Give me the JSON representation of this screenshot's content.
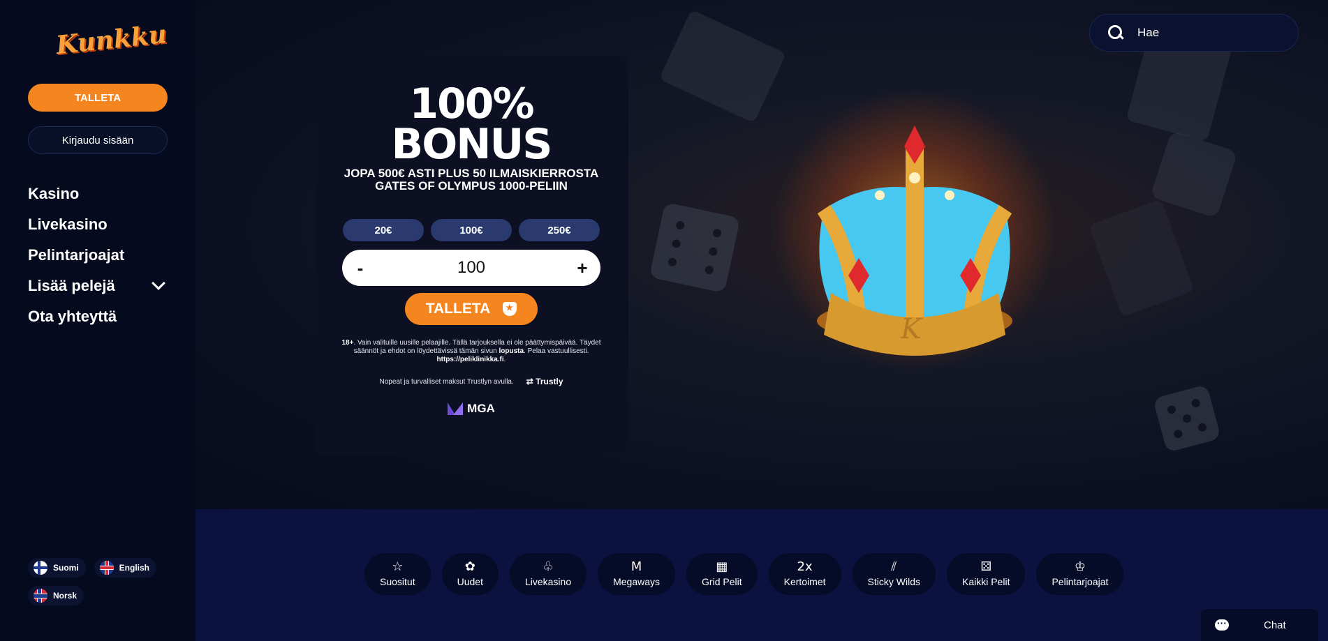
{
  "brand": {
    "logo_text": "Kunkku"
  },
  "sidebar": {
    "deposit_label": "TALLETA",
    "login_label": "Kirjaudu sisään",
    "nav": [
      {
        "label": "Kasino"
      },
      {
        "label": "Livekasino"
      },
      {
        "label": "Pelintarjoajat"
      },
      {
        "label": "Lisää pelejä"
      },
      {
        "label": "Ota yhteyttä"
      }
    ],
    "languages": [
      {
        "label": "Suomi"
      },
      {
        "label": "English"
      },
      {
        "label": "Norsk"
      }
    ]
  },
  "search": {
    "placeholder": "Hae"
  },
  "bonus": {
    "line1": "100%",
    "line2": "BONUS",
    "subtitle": "JOPA 500€ ASTI PLUS 50 ILMAISKIERROSTA GATES OF OLYMPUS 1000-PELIIN",
    "amounts": [
      "20€",
      "100€",
      "250€"
    ],
    "stepper_minus": "-",
    "stepper_value": "100",
    "stepper_plus": "+",
    "deposit_label": "TALLETA",
    "fine_age": "18+",
    "fine_text_1": ". Vain valituille uusille pelaajille. Tällä tarjouksella ei ole päättymispäivää. Täydet säännöt ja ehdot on löydettävissä tämän sivun ",
    "fine_link": "lopusta",
    "fine_text_2": ". Pelaa vastuullisesti.",
    "fine_url": "https://peliklinikka.fi",
    "trustly_text": "Nopeat ja turvalliset maksut Trustlyn avulla.",
    "trustly_logo": "Trustly",
    "mga_label": "MGA"
  },
  "categories": [
    {
      "label": "Suositut",
      "icon": "☆"
    },
    {
      "label": "Uudet",
      "icon": "✿"
    },
    {
      "label": "Livekasino",
      "icon": "♧"
    },
    {
      "label": "Megaways",
      "icon": "M"
    },
    {
      "label": "Grid Pelit",
      "icon": "▦"
    },
    {
      "label": "Kertoimet",
      "icon": "2x"
    },
    {
      "label": "Sticky Wilds",
      "icon": "⫽"
    },
    {
      "label": "Kaikki Pelit",
      "icon": "⚄"
    },
    {
      "label": "Pelintarjoajat",
      "icon": "♔"
    }
  ],
  "chat": {
    "label": "Chat"
  },
  "colors": {
    "accent": "#f5861f",
    "background": "#050a1e",
    "panel": "#0c1022",
    "amount_pill": "#2a3a6e"
  }
}
